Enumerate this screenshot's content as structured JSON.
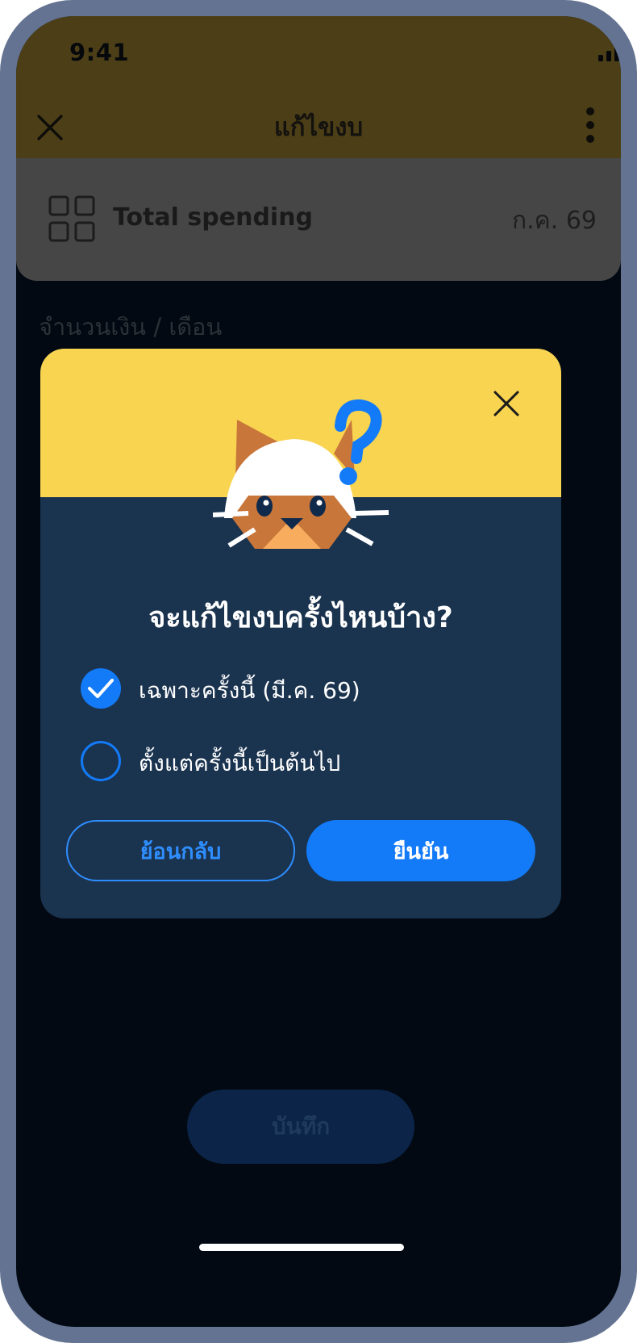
{
  "status_bar": {
    "time": "9:41"
  },
  "header": {
    "title": "แก้ไขงบ"
  },
  "budget": {
    "name": "Total spending",
    "month": "ก.ค. 69"
  },
  "amount_label": "จำนวนเงิน / เดือน",
  "save_button_label": "บันทึก",
  "modal": {
    "title": "จะแก้ไขงบครั้งไหนบ้าง?",
    "options": [
      {
        "label": "เฉพาะครั้งนี้ (มี.ค. 69)",
        "selected": true
      },
      {
        "label": "ตั้งแต่ครั้งนี้เป็นต้นไป",
        "selected": false
      }
    ],
    "back_label": "ย้อนกลับ",
    "confirm_label": "ยืนยัน"
  },
  "colors": {
    "accent": "#137bf8",
    "modal_top": "#f9d450",
    "modal_body": "#1a334f",
    "header_bg": "#4c3f17",
    "card_bg": "#464646",
    "frame": "#637391"
  },
  "icons": [
    "signal-icon",
    "wifi-icon",
    "battery-icon",
    "close-icon",
    "more-icon",
    "grid-icon",
    "cat-mascot-icon",
    "check-icon"
  ]
}
